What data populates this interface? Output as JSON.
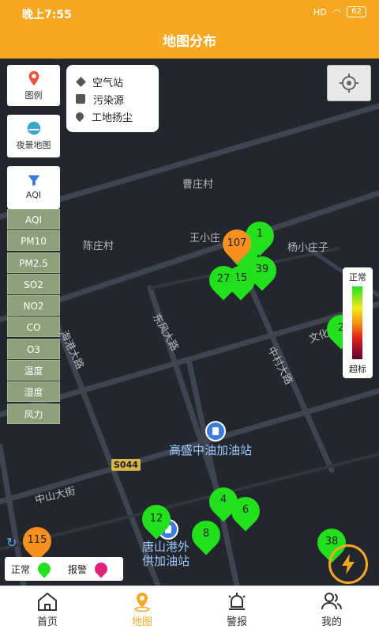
{
  "status_bar": {
    "time": "晚上7:55",
    "battery": "62",
    "signal": "HD"
  },
  "header": {
    "title": "地图分布"
  },
  "side_buttons": [
    {
      "label": "图例",
      "icon": "map-pin-icon"
    },
    {
      "label": "夜景地图",
      "icon": "night-map-icon"
    },
    {
      "label": "AQI",
      "icon": "aqi-icon"
    }
  ],
  "legend": [
    {
      "label": "空气站",
      "icon": "diamond-icon"
    },
    {
      "label": "污染源",
      "icon": "bubble-icon"
    },
    {
      "label": "工地扬尘",
      "icon": "pin-icon"
    }
  ],
  "pollutants": [
    "AQI",
    "PM10",
    "PM2.5",
    "SO2",
    "NO2",
    "CO",
    "O3",
    "温度",
    "湿度",
    "风力"
  ],
  "scale": {
    "top": "正常",
    "bottom": "超标"
  },
  "map_labels": {
    "caozhuang": "曹庄村",
    "wangxiaozhuang": "王小庄",
    "chenzhuang": "陈庄村",
    "yangxiaozhuangzi": "杨小庄子",
    "dongfeng": "东风大路",
    "haigang": "海港大路",
    "zhongcun": "中村大路",
    "wenhua": "文化",
    "gaosheng": "高盛中油加油站",
    "zhongshan": "中山大街",
    "tangshangang_1": "唐山港外",
    "tangshangang_2": "供加油站",
    "road_code": "S044"
  },
  "pins": [
    {
      "value": "1",
      "color": "green"
    },
    {
      "value": "107",
      "color": "orange"
    },
    {
      "value": "2",
      "color": "green"
    },
    {
      "value": "39",
      "color": "green"
    },
    {
      "value": "15",
      "color": "green"
    },
    {
      "value": "27",
      "color": "green"
    },
    {
      "value": "2",
      "color": "green"
    },
    {
      "value": "4",
      "color": "green"
    },
    {
      "value": "6",
      "color": "green"
    },
    {
      "value": "12",
      "color": "green"
    },
    {
      "value": "8",
      "color": "green"
    },
    {
      "value": "38",
      "color": "green"
    },
    {
      "value": "115",
      "color": "orange"
    }
  ],
  "status_legend": {
    "normal": "正常",
    "alarm": "报警"
  },
  "tabs": [
    {
      "label": "首页",
      "icon": "home-icon",
      "active": false
    },
    {
      "label": "地图",
      "icon": "map-location-icon",
      "active": true
    },
    {
      "label": "警报",
      "icon": "alarm-light-icon",
      "active": false
    },
    {
      "label": "我的",
      "icon": "user-icon",
      "active": false
    }
  ],
  "colors": {
    "accent": "#f7a823",
    "normal": "#22e01d",
    "alarm": "#e0227a",
    "warning": "#f7901e",
    "map_bg": "#23262d"
  }
}
